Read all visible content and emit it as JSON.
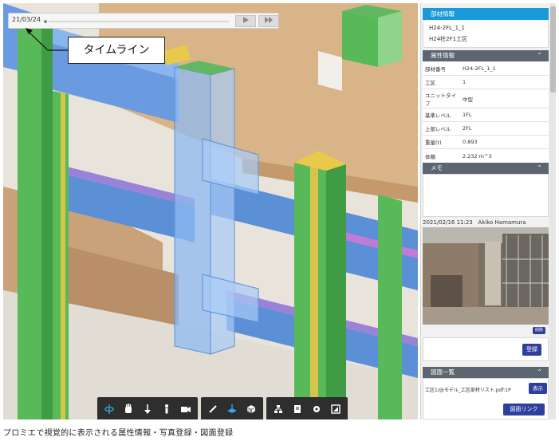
{
  "timeline": {
    "date": "21/03/24",
    "play_icon": "play-icon",
    "ff_icon": "fast-forward-icon"
  },
  "callout": {
    "label": "タイムライン"
  },
  "panel": {
    "header": "部材情報",
    "member_id": "H24-2FL_1_1",
    "member_name": "H24柱2F1工区",
    "attributes": {
      "title": "属性情報",
      "rows": [
        {
          "key": "部材番号",
          "value": "H24-2FL_1_1"
        },
        {
          "key": "工区",
          "value": "1"
        },
        {
          "key": "ユニットタイプ",
          "value": "中型"
        },
        {
          "key": "基準レベル",
          "value": "1FL"
        },
        {
          "key": "上部レベル",
          "value": "2FL"
        },
        {
          "key": "重量(t)",
          "value": "0.893"
        },
        {
          "key": "体積",
          "value": "2.232 m^3"
        }
      ]
    },
    "memo": {
      "title": "メモ",
      "timestamp": "2021/02/16 11:23   Akiko Hamamura",
      "delete_label": "削除",
      "register_label": "登録"
    },
    "drawings": {
      "title": "図面一覧",
      "file": "工区1/@モデル_工区部材リスト.pdf:1P",
      "show_label": "表示",
      "link_label": "図面リンク"
    }
  },
  "toolbar": {
    "groups": [
      [
        "orbit-icon",
        "pan-hand-icon",
        "walk-down-icon",
        "person-icon",
        "camera-icon"
      ],
      [
        "pencil-icon",
        "section-plane-icon",
        "cube-icon"
      ],
      [
        "tree-icon",
        "document-icon",
        "settings-icon",
        "fullscreen-icon"
      ]
    ],
    "active": "section-plane-icon"
  },
  "caption": "プロミエで視覚的に表示される属性情報・写真登録・図面登録",
  "colors": {
    "accent_blue": "#1a9ad8",
    "section_gray": "#5b6670",
    "button_navy": "#2f3f9e",
    "column_green": "#5cc25a",
    "beam_blue": "#5b8fd6",
    "slab_tan": "#d9b489"
  }
}
